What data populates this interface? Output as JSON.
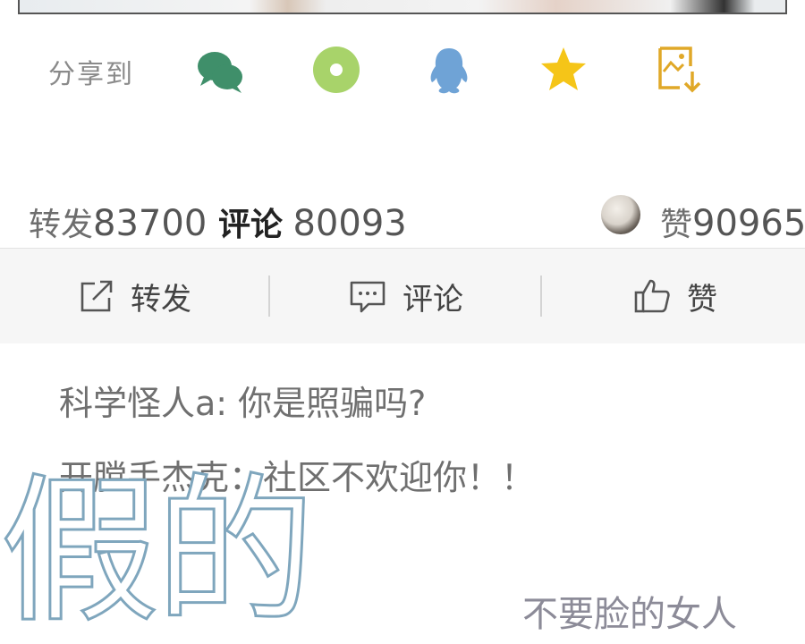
{
  "share": {
    "label": "分享到",
    "icons": [
      "wechat-icon",
      "moments-icon",
      "qq-icon",
      "favorite-star-icon",
      "save-image-icon"
    ],
    "colors": {
      "wechat": "#3f8f6a",
      "moments": "#a8d36a",
      "qq": "#6fa3d6",
      "star": "#f5c518",
      "save": "#e0a828"
    }
  },
  "stats": {
    "repost_label": "转发",
    "repost_count": "83700",
    "comment_label": "评论",
    "comment_count": "80093",
    "like_label": "赞",
    "like_count": "90965"
  },
  "actions": {
    "repost": "转发",
    "comment": "评论",
    "like": "赞"
  },
  "comments": [
    "科学怪人a: 你是照骗吗?",
    "开膛手杰克：社区不欢迎你！！"
  ],
  "overlay": {
    "big_text": "假的",
    "caption": "不要脸的女人"
  }
}
